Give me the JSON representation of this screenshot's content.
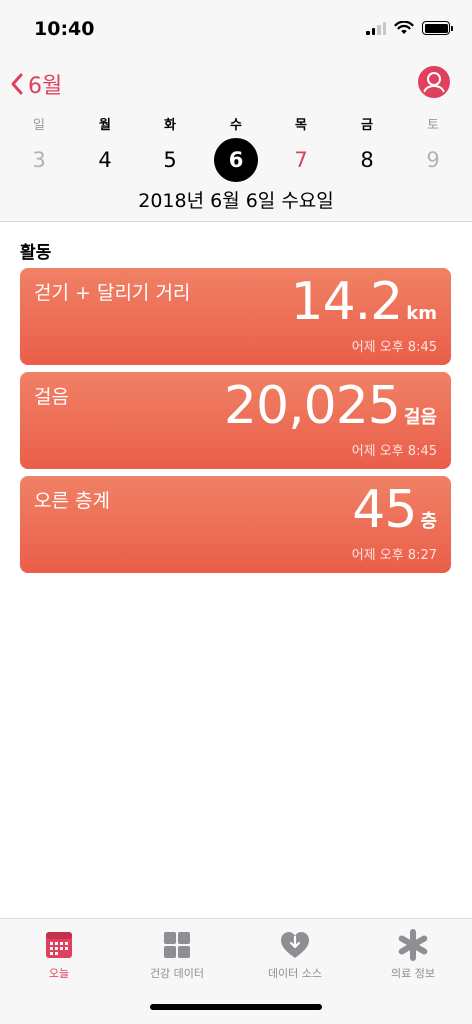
{
  "status": {
    "time": "10:40"
  },
  "header": {
    "back_label": "6월",
    "weekdays": [
      "일",
      "월",
      "화",
      "수",
      "목",
      "금",
      "토"
    ],
    "dates": [
      "3",
      "4",
      "5",
      "6",
      "7",
      "8",
      "9"
    ],
    "selected_date": "2018년 6월 6일 수요일"
  },
  "content": {
    "section_title": "활동",
    "cards": [
      {
        "label": "걷기 + 달리기 거리",
        "value": "14.2",
        "unit": "km",
        "time": "어제 오후 8:45"
      },
      {
        "label": "걸음",
        "value": "20,025",
        "unit": "걸음",
        "time": "어제 오후 8:45"
      },
      {
        "label": "오른 층계",
        "value": "45",
        "unit": "층",
        "time": "어제 오후 8:27"
      }
    ]
  },
  "tabs": [
    {
      "label": "오늘",
      "icon": "calendar-icon"
    },
    {
      "label": "건강 데이터",
      "icon": "grid-icon"
    },
    {
      "label": "데이터 소스",
      "icon": "heart-download-icon"
    },
    {
      "label": "의료 정보",
      "icon": "asterisk-icon"
    }
  ],
  "colors": {
    "accent": "#e0405e",
    "card_top": "#f08165",
    "card_bottom": "#ea5e4a"
  }
}
